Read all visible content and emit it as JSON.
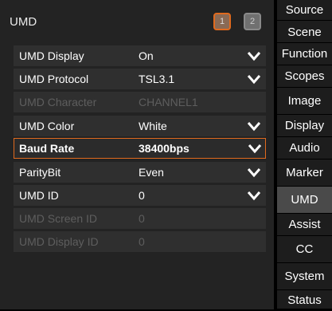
{
  "panel": {
    "title": "UMD",
    "page_buttons": [
      {
        "label": "1",
        "state": "active"
      },
      {
        "label": "2",
        "state": "inactive"
      }
    ]
  },
  "settings": [
    {
      "label": "UMD Display",
      "value": "On",
      "dropdown": true,
      "enabled": true
    },
    {
      "label": "UMD Protocol",
      "value": "TSL3.1",
      "dropdown": true,
      "enabled": true
    },
    {
      "label": "UMD Character",
      "value": "CHANNEL1",
      "dropdown": false,
      "enabled": false
    },
    {
      "label": "UMD Color",
      "value": "White",
      "dropdown": true,
      "enabled": true
    },
    {
      "label": "Baud Rate",
      "value": "38400bps",
      "dropdown": true,
      "enabled": true,
      "selected": true
    },
    {
      "label": "ParityBit",
      "value": "Even",
      "dropdown": true,
      "enabled": true
    },
    {
      "label": "UMD ID",
      "value": "0",
      "dropdown": true,
      "enabled": true
    },
    {
      "label": "UMD Screen ID",
      "value": "0",
      "dropdown": false,
      "enabled": false
    },
    {
      "label": "UMD Display ID",
      "value": "0",
      "dropdown": false,
      "enabled": false
    }
  ],
  "sidebar": {
    "items": [
      {
        "label": "Source"
      },
      {
        "label": "Scene"
      },
      {
        "label": "Function"
      },
      {
        "label": "Scopes"
      },
      {
        "label": "Image"
      },
      {
        "label": "Display"
      },
      {
        "label": "Audio"
      },
      {
        "label": "Marker"
      },
      {
        "label": "UMD",
        "active": true
      },
      {
        "label": "Assist"
      },
      {
        "label": "CC"
      },
      {
        "label": "System"
      },
      {
        "label": "Status"
      }
    ]
  },
  "colors": {
    "accent": "#e06a1e",
    "panel_bg": "#232323",
    "row_bg": "#2f2f2f",
    "disabled_text": "#5e5e5e",
    "sidebar_bg": "#1d1d1d",
    "sidebar_active_bg": "#4a4a4a"
  },
  "icons": {
    "dropdown": "chevron-down-icon"
  }
}
